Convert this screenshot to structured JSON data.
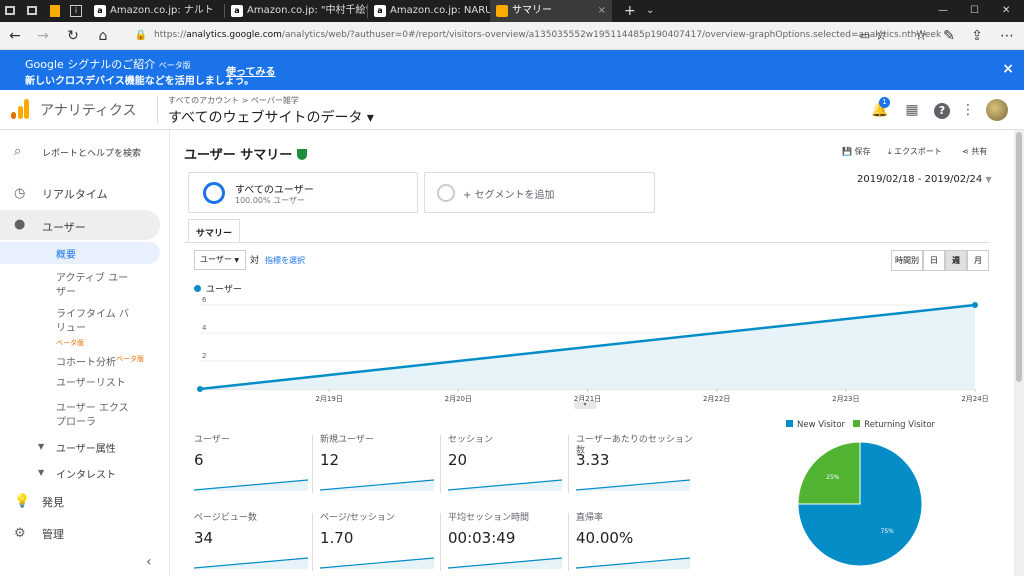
{
  "browser": {
    "tabs": [
      {
        "label": "",
        "icon": "app-icon"
      },
      {
        "label": "",
        "icon": "ga-icon"
      },
      {
        "label": "Amazon.co.jp: ナルト",
        "icon": "a"
      },
      {
        "label": "Amazon.co.jp: \"中村千絵\": F",
        "icon": "a"
      },
      {
        "label": "Amazon.co.jp: NARUTO-ナル",
        "icon": "a"
      },
      {
        "label": "サマリー",
        "icon": "ga"
      }
    ],
    "url_prefix": "https://",
    "url_host": "analytics.google.com",
    "url_path": "/analytics/web/?authuser=0#/report/visitors-overview/a135035552w195114485p190407417/overview-graphOptions.selected=analytics.nthWeek"
  },
  "notification": {
    "line1": "Google シグナルのご紹介",
    "beta": "ベータ版",
    "line2": "新しいクロスデバイス機能などを活用しましょう。",
    "action": "使ってみる",
    "close": "×"
  },
  "header": {
    "app_name": "アナリティクス",
    "breadcrumb": "すべてのアカウント > ペーパー雑学",
    "property": "すべてのウェブサイトのデータ ▾",
    "notifications_count": "1"
  },
  "sidebar": {
    "search": "レポートとヘルプを検索",
    "realtime": "リアルタイム",
    "user": "ユーザー",
    "subitems": [
      "概要",
      "アクティブ ユーザー",
      "ライフタイム バリュー",
      "コホート分析",
      "ユーザーリスト",
      "ユーザー エクスプローラ"
    ],
    "lifetime_beta": "ベータ版",
    "cohort_beta": "ベータ版",
    "user_attr": "ユーザー属性",
    "interest": "インタレスト",
    "discover": "発見",
    "admin": "管理",
    "collapse": "‹"
  },
  "report": {
    "title": "ユーザー サマリー",
    "save": "保存",
    "export": "エクスポート",
    "share": "共有",
    "segment_name": "すべてのユーザー",
    "segment_pct": "100.00% ユーザー",
    "add_segment": "+ セグメントを追加",
    "date_range": "2019/02/18 - 2019/02/24",
    "tab_summary": "サマリー",
    "metric_select": "ユーザー",
    "vs": "対",
    "select_metric": "指標を選択",
    "period_buttons": [
      "時間別",
      "日",
      "週",
      "月"
    ],
    "active_period": "週"
  },
  "chart_data": {
    "type": "area",
    "series": [
      {
        "name": "ユーザー",
        "values": [
          0,
          6
        ]
      }
    ],
    "x": [
      "2019/02/18",
      "2019/02/24"
    ],
    "x_tick_labels": [
      "2月19日",
      "2月20日",
      "2月21日",
      "2月22日",
      "2月23日",
      "2月24日"
    ],
    "y_ticks": [
      "6",
      "4",
      "2"
    ],
    "ylim": [
      0,
      6
    ],
    "color": "#058dc7",
    "fill": "#e6f3f9"
  },
  "metrics": [
    {
      "label": "ユーザー",
      "value": "6"
    },
    {
      "label": "新規ユーザー",
      "value": "12"
    },
    {
      "label": "セッション",
      "value": "20"
    },
    {
      "label": "ユーザーあたりのセッション数",
      "value": "3.33"
    },
    {
      "label": "ページビュー数",
      "value": "34"
    },
    {
      "label": "ページ/セッション",
      "value": "1.70"
    },
    {
      "label": "平均セッション時間",
      "value": "00:03:49"
    },
    {
      "label": "直帰率",
      "value": "40.00%"
    }
  ],
  "pie": {
    "slices": [
      {
        "name": "New Visitor",
        "value": 75,
        "label": "75%",
        "color": "#058dc7"
      },
      {
        "name": "Returning Visitor",
        "value": 25,
        "label": "25%",
        "color": "#50b432"
      }
    ]
  }
}
